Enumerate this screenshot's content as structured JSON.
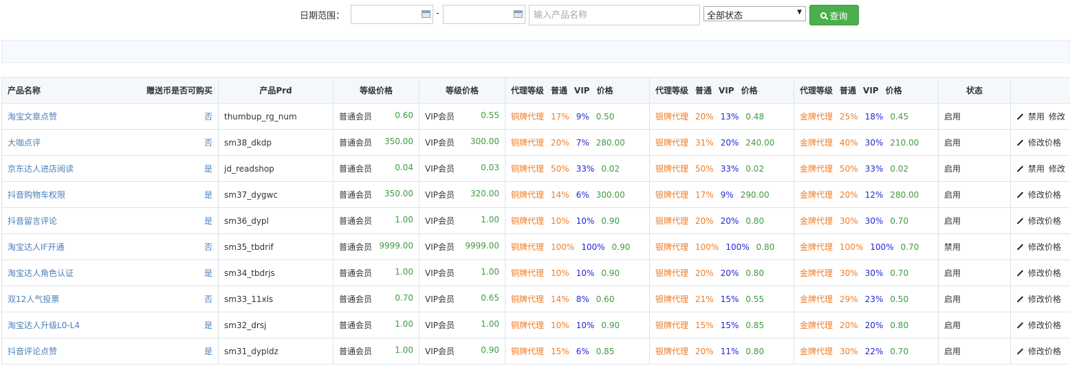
{
  "filter": {
    "date_label": "日期范围：",
    "date_separator": "-",
    "start_date": "",
    "end_date": "",
    "product_placeholder": "输入产品名称",
    "status_value": "全部状态",
    "query_label": "查询"
  },
  "table": {
    "headers": {
      "name": "产品名称",
      "gift": "赠送币是否可购买",
      "prd": "产品Prd",
      "level_price_1": "等级价格",
      "level_price_2": "等级价格",
      "agent_level": "代理等级",
      "normal": "普通",
      "vip": "VIP",
      "price": "价格",
      "status": "状态",
      "ops": ""
    },
    "rows": [
      {
        "name": "淘宝文章点赞",
        "gift": "否",
        "prd": "thumbup_rg_num",
        "normal_label": "普通会员",
        "normal_price": "0.60",
        "vip_label": "VIP会员",
        "vip_price": "0.55",
        "copper": {
          "label": "铜牌代理",
          "n": "17%",
          "v": "9%",
          "p": "0.50"
        },
        "silver": {
          "label": "银牌代理",
          "n": "20%",
          "v": "13%",
          "p": "0.48"
        },
        "gold": {
          "label": "金牌代理",
          "n": "25%",
          "v": "18%",
          "p": "0.45"
        },
        "status": "启用",
        "op1": "禁用",
        "op2": "修改"
      },
      {
        "name": "大咖点评",
        "gift": "否",
        "prd": "sm38_dkdp",
        "normal_label": "普通会员",
        "normal_price": "350.00",
        "vip_label": "VIP会员",
        "vip_price": "300.00",
        "copper": {
          "label": "铜牌代理",
          "n": "20%",
          "v": "7%",
          "p": "280.00"
        },
        "silver": {
          "label": "银牌代理",
          "n": "31%",
          "v": "20%",
          "p": "240.00"
        },
        "gold": {
          "label": "金牌代理",
          "n": "40%",
          "v": "30%",
          "p": "210.00"
        },
        "status": "启用",
        "op1": "修改价格",
        "op2": ""
      },
      {
        "name": "京东达人进店阅读",
        "gift": "是",
        "prd": "jd_readshop",
        "normal_label": "普通会员",
        "normal_price": "0.04",
        "vip_label": "VIP会员",
        "vip_price": "0.03",
        "copper": {
          "label": "铜牌代理",
          "n": "50%",
          "v": "33%",
          "p": "0.02"
        },
        "silver": {
          "label": "银牌代理",
          "n": "50%",
          "v": "33%",
          "p": "0.02"
        },
        "gold": {
          "label": "金牌代理",
          "n": "50%",
          "v": "33%",
          "p": "0.02"
        },
        "status": "启用",
        "op1": "禁用",
        "op2": "修改"
      },
      {
        "name": "抖音购物车权限",
        "gift": "是",
        "prd": "sm37_dygwc",
        "normal_label": "普通会员",
        "normal_price": "350.00",
        "vip_label": "VIP会员",
        "vip_price": "320.00",
        "copper": {
          "label": "铜牌代理",
          "n": "14%",
          "v": "6%",
          "p": "300.00"
        },
        "silver": {
          "label": "银牌代理",
          "n": "17%",
          "v": "9%",
          "p": "290.00"
        },
        "gold": {
          "label": "金牌代理",
          "n": "20%",
          "v": "12%",
          "p": "280.00"
        },
        "status": "启用",
        "op1": "修改价格",
        "op2": ""
      },
      {
        "name": "抖音留言评论",
        "gift": "是",
        "prd": "sm36_dypl",
        "normal_label": "普通会员",
        "normal_price": "1.00",
        "vip_label": "VIP会员",
        "vip_price": "1.00",
        "copper": {
          "label": "铜牌代理",
          "n": "10%",
          "v": "10%",
          "p": "0.90"
        },
        "silver": {
          "label": "银牌代理",
          "n": "20%",
          "v": "20%",
          "p": "0.80"
        },
        "gold": {
          "label": "金牌代理",
          "n": "30%",
          "v": "30%",
          "p": "0.70"
        },
        "status": "启用",
        "op1": "修改价格",
        "op2": ""
      },
      {
        "name": "淘宝达人IF开通",
        "gift": "否",
        "prd": "sm35_tbdrif",
        "normal_label": "普通会员",
        "normal_price": "9999.00",
        "vip_label": "VIP会员",
        "vip_price": "9999.00",
        "copper": {
          "label": "铜牌代理",
          "n": "100%",
          "v": "100%",
          "p": "0.90"
        },
        "silver": {
          "label": "银牌代理",
          "n": "100%",
          "v": "100%",
          "p": "0.80"
        },
        "gold": {
          "label": "金牌代理",
          "n": "100%",
          "v": "100%",
          "p": "0.70"
        },
        "status": "禁用",
        "op1": "修改价格",
        "op2": ""
      },
      {
        "name": "淘宝达人角色认证",
        "gift": "是",
        "prd": "sm34_tbdrjs",
        "normal_label": "普通会员",
        "normal_price": "1.00",
        "vip_label": "VIP会员",
        "vip_price": "1.00",
        "copper": {
          "label": "铜牌代理",
          "n": "10%",
          "v": "10%",
          "p": "0.90"
        },
        "silver": {
          "label": "银牌代理",
          "n": "20%",
          "v": "20%",
          "p": "0.80"
        },
        "gold": {
          "label": "金牌代理",
          "n": "30%",
          "v": "30%",
          "p": "0.70"
        },
        "status": "启用",
        "op1": "修改价格",
        "op2": ""
      },
      {
        "name": "双12人气投票",
        "gift": "否",
        "prd": "sm33_11xls",
        "normal_label": "普通会员",
        "normal_price": "0.70",
        "vip_label": "VIP会员",
        "vip_price": "0.65",
        "copper": {
          "label": "铜牌代理",
          "n": "14%",
          "v": "8%",
          "p": "0.60"
        },
        "silver": {
          "label": "银牌代理",
          "n": "21%",
          "v": "15%",
          "p": "0.55"
        },
        "gold": {
          "label": "金牌代理",
          "n": "29%",
          "v": "23%",
          "p": "0.50"
        },
        "status": "启用",
        "op1": "修改价格",
        "op2": ""
      },
      {
        "name": "淘宝达人升级L0-L4",
        "gift": "是",
        "prd": "sm32_drsj",
        "normal_label": "普通会员",
        "normal_price": "1.00",
        "vip_label": "VIP会员",
        "vip_price": "1.00",
        "copper": {
          "label": "铜牌代理",
          "n": "10%",
          "v": "10%",
          "p": "0.90"
        },
        "silver": {
          "label": "银牌代理",
          "n": "15%",
          "v": "15%",
          "p": "0.85"
        },
        "gold": {
          "label": "金牌代理",
          "n": "20%",
          "v": "20%",
          "p": "0.80"
        },
        "status": "启用",
        "op1": "修改价格",
        "op2": ""
      },
      {
        "name": "抖音评论点赞",
        "gift": "是",
        "prd": "sm31_dypldz",
        "normal_label": "普通会员",
        "normal_price": "1.00",
        "vip_label": "VIP会员",
        "vip_price": "0.90",
        "copper": {
          "label": "铜牌代理",
          "n": "15%",
          "v": "6%",
          "p": "0.85"
        },
        "silver": {
          "label": "银牌代理",
          "n": "20%",
          "v": "11%",
          "p": "0.80"
        },
        "gold": {
          "label": "金牌代理",
          "n": "30%",
          "v": "22%",
          "p": "0.70"
        },
        "status": "启用",
        "op1": "修改价格",
        "op2": ""
      }
    ]
  }
}
